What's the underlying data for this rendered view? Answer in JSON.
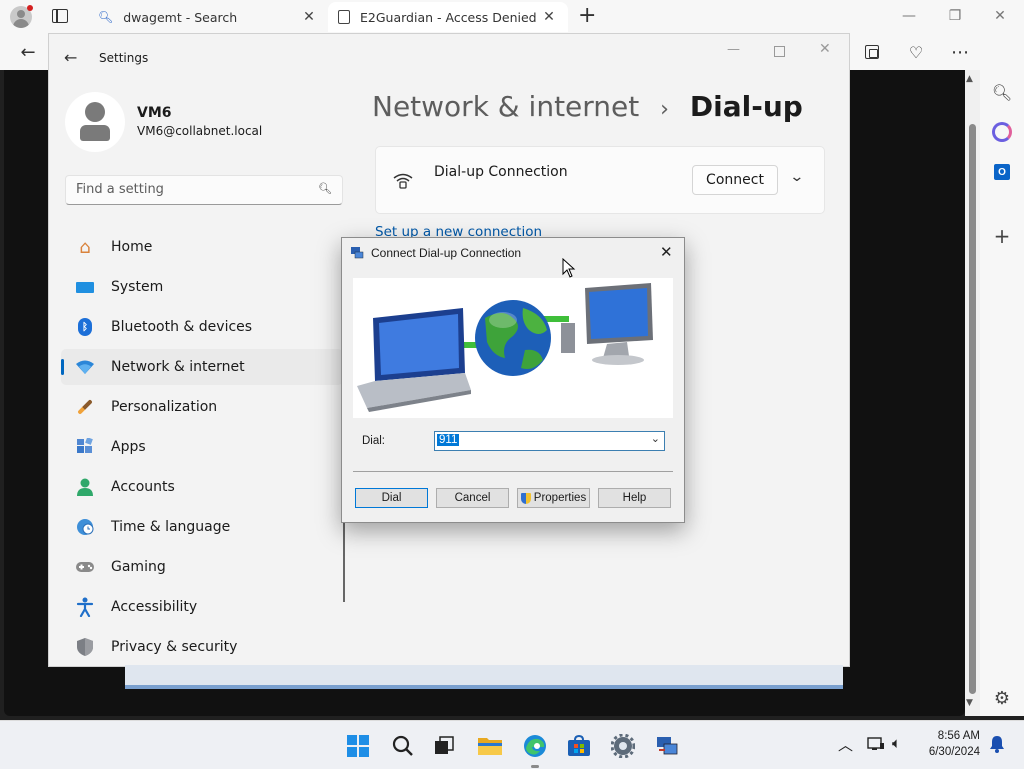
{
  "browser": {
    "tabs": [
      {
        "title": "dwagemt - Search"
      },
      {
        "title": "E2Guardian - Access Denied"
      }
    ],
    "new_tab": "+",
    "win_controls": {
      "minimize": "—",
      "restore": "❐",
      "close": "✕"
    }
  },
  "settings": {
    "title": "Settings",
    "user": {
      "name": "VM6",
      "email": "VM6@collabnet.local"
    },
    "search": {
      "placeholder": "Find a setting"
    },
    "nav": [
      {
        "label": "Home",
        "icon": "home-icon"
      },
      {
        "label": "System",
        "icon": "system-icon"
      },
      {
        "label": "Bluetooth & devices",
        "icon": "bluetooth-icon"
      },
      {
        "label": "Network & internet",
        "icon": "wifi-icon"
      },
      {
        "label": "Personalization",
        "icon": "brush-icon"
      },
      {
        "label": "Apps",
        "icon": "apps-icon"
      },
      {
        "label": "Accounts",
        "icon": "account-icon"
      },
      {
        "label": "Time & language",
        "icon": "globe-clock-icon"
      },
      {
        "label": "Gaming",
        "icon": "gamepad-icon"
      },
      {
        "label": "Accessibility",
        "icon": "accessibility-icon"
      },
      {
        "label": "Privacy & security",
        "icon": "shield-icon"
      }
    ],
    "breadcrumb": {
      "parent": "Network & internet",
      "separator": "›",
      "current": "Dial-up"
    },
    "connection": {
      "name": "Dial-up Connection",
      "connect_label": "Connect"
    },
    "setup_link": "Set up a new connection"
  },
  "dialog": {
    "title": "Connect Dial-up Connection",
    "dial_label": "Dial:",
    "dial_value": "911",
    "buttons": {
      "dial": "Dial",
      "cancel": "Cancel",
      "properties": "Properties",
      "help": "Help"
    }
  },
  "taskbar": {
    "time": "8:56 AM",
    "date": "6/30/2024"
  }
}
